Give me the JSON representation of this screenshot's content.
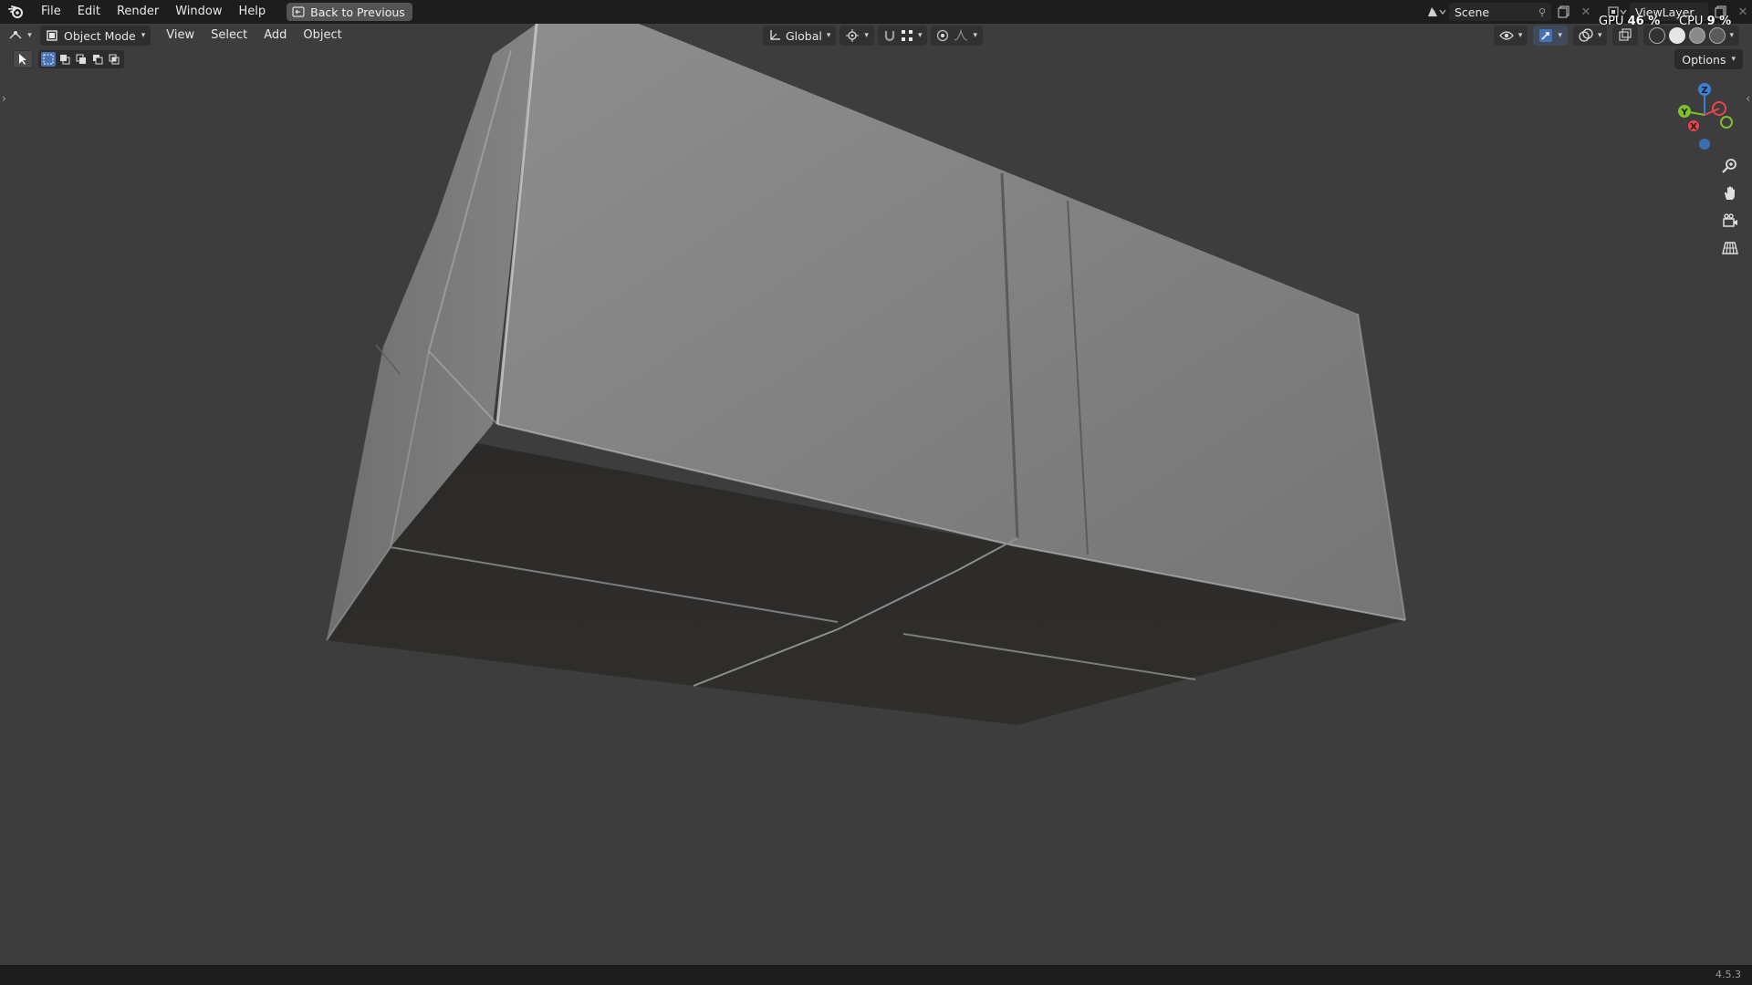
{
  "menu": {
    "items": [
      "File",
      "Edit",
      "Render",
      "Window",
      "Help"
    ],
    "back_button": "Back to Previous"
  },
  "scene": {
    "label": "Scene"
  },
  "view_layer": {
    "label": "ViewLayer"
  },
  "stats": {
    "gpu_label": "GPU",
    "gpu_value": "46 %",
    "cpu_label": "CPU",
    "cpu_value": "9 %"
  },
  "header": {
    "mode": "Object Mode",
    "menus": [
      "View",
      "Select",
      "Add",
      "Object"
    ],
    "transform_orientation": "Global",
    "options_label": "Options"
  },
  "gizmo": {
    "z": "Z",
    "y": "Y",
    "x": "X"
  },
  "icons": {
    "logo": "blender-logo-icon",
    "back": "back-to-previous-icon",
    "editor_type": "3d-viewport-editor-icon",
    "pivot": "transform-pivot-icon",
    "snap": "snap-magnet-icon",
    "proportional": "proportional-editing-icon",
    "overlays": "overlays-icon",
    "gizmos": "gizmo-toggle-icon",
    "xray": "xray-icon",
    "zoom": "zoom-icon",
    "pan": "pan-hand-icon",
    "camera": "camera-view-icon",
    "perspective": "perspective-grid-icon"
  },
  "colors": {
    "viewport_bg": "#3d3d3d",
    "bar_bg": "#1d1d1d",
    "selection_blue": "#4772b3",
    "axis_x": "#e8454f",
    "axis_y": "#7fbf2a",
    "axis_z": "#3b80d8"
  },
  "version": "4.5.3"
}
